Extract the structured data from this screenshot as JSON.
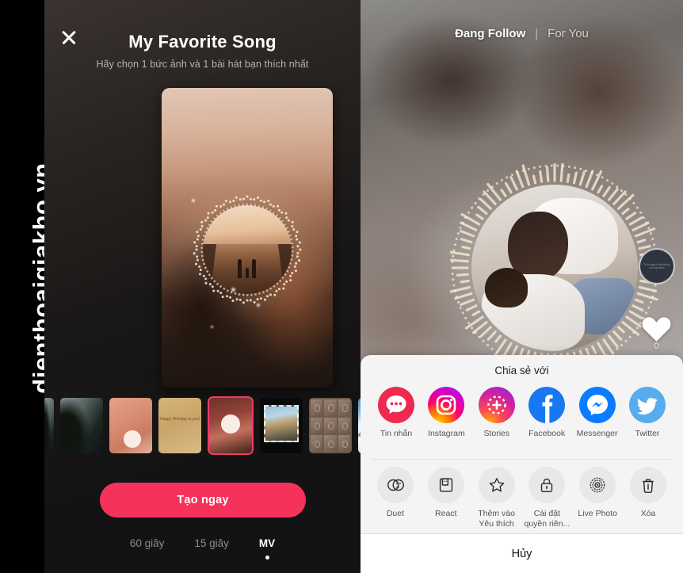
{
  "watermark": {
    "text": "dienthoaigiakho.vn"
  },
  "left_panel": {
    "close_icon": "close-icon",
    "title": "My Favorite Song",
    "subtitle": "Hãy chọn 1 bức ảnh và 1 bài hát bạn thích nhất",
    "create_button": "Tạo ngay",
    "accent_color": "#f5325b",
    "thumbnails": [
      {
        "name": "thumb-edge-left",
        "style": "th-forest",
        "caption": "",
        "selected": false,
        "clipped": "left"
      },
      {
        "name": "thumb-forest",
        "style": "th-forest",
        "caption": "",
        "selected": false,
        "clipped": ""
      },
      {
        "name": "thumb-pink-marble",
        "style": "th-pink",
        "caption": "",
        "selected": false,
        "clipped": ""
      },
      {
        "name": "thumb-birthday-gold",
        "style": "th-gold",
        "caption": "Happy Birthday to you!",
        "selected": false,
        "clipped": ""
      },
      {
        "name": "thumb-my-favorite-song",
        "style": "th-sel",
        "caption": "",
        "selected": true,
        "clipped": ""
      },
      {
        "name": "thumb-polaroid-stamp",
        "style": "th-stamp",
        "caption": "",
        "selected": false,
        "clipped": ""
      },
      {
        "name": "thumb-photo-grid",
        "style": "th-grid",
        "caption": "",
        "selected": false,
        "clipped": ""
      },
      {
        "name": "thumb-snow-mountain",
        "style": "th-snow",
        "caption": "",
        "selected": false,
        "clipped": ""
      },
      {
        "name": "thumb-edge-right",
        "style": "th-snow",
        "caption": "",
        "selected": false,
        "clipped": "right"
      }
    ],
    "mode_tabs": [
      {
        "label": "60 giây",
        "active": false
      },
      {
        "label": "15 giây",
        "active": false
      },
      {
        "label": "MV",
        "active": true
      }
    ]
  },
  "right_panel": {
    "feed_tabs": {
      "following": "Đang Follow",
      "separator": "|",
      "for_you": "For You"
    },
    "music_disc_text": "Tôi là người hát bài này nếu bạn thích",
    "like_count": "0",
    "share_sheet": {
      "title": "Chia sẻ với",
      "share_targets": [
        {
          "label": "Tin nhắn",
          "icon": "message-bubble-icon",
          "color": "#ef2950"
        },
        {
          "label": "Instagram",
          "icon": "instagram-icon",
          "color": "#d6249f"
        },
        {
          "label": "Stories",
          "icon": "instagram-stories-icon",
          "color": "#c13584"
        },
        {
          "label": "Facebook",
          "icon": "facebook-icon",
          "color": "#1877f2"
        },
        {
          "label": "Messenger",
          "icon": "messenger-icon",
          "color": "#0a7cff"
        },
        {
          "label": "Twitter",
          "icon": "twitter-bird-icon",
          "color": "#55acee"
        }
      ],
      "actions": [
        {
          "label": "Duet",
          "icon": "duet-circles-icon"
        },
        {
          "label": "React",
          "icon": "react-frame-icon"
        },
        {
          "label": "Thêm vào Yêu thích",
          "icon": "star-icon"
        },
        {
          "label": "Cài đặt quyền riên...",
          "icon": "lock-icon"
        },
        {
          "label": "Live Photo",
          "icon": "live-photo-icon"
        },
        {
          "label": "Xóa",
          "icon": "trash-icon"
        }
      ],
      "cancel": "Hủy"
    }
  }
}
